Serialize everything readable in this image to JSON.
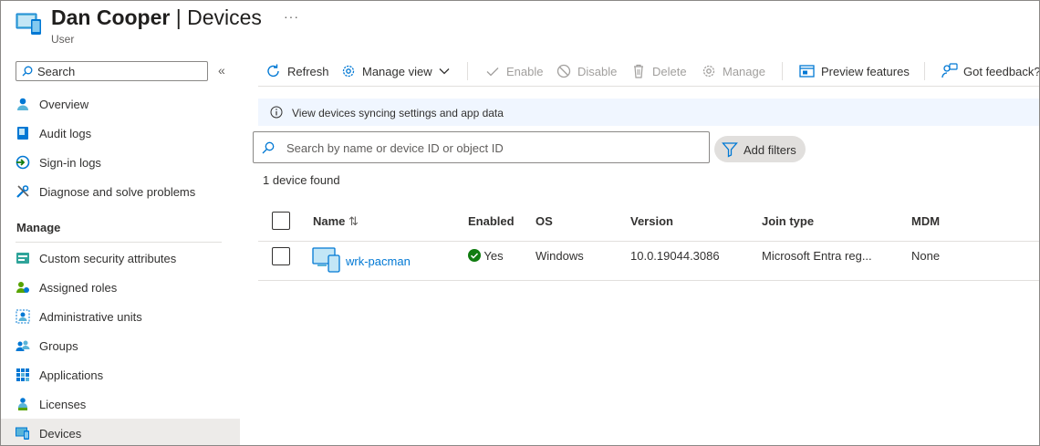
{
  "header": {
    "user": "Dan Cooper",
    "separator": " | ",
    "page": "Devices",
    "more": "···",
    "subtitle": "User"
  },
  "sidebar": {
    "search_placeholder": "Search",
    "collapse": "«",
    "items": [
      {
        "label": "Overview",
        "icon": "person-icon"
      },
      {
        "label": "Audit logs",
        "icon": "audit-log-icon"
      },
      {
        "label": "Sign-in logs",
        "icon": "sign-in-icon"
      },
      {
        "label": "Diagnose and solve problems",
        "icon": "wrench-icon"
      }
    ],
    "section_label": "Manage",
    "manage_items": [
      {
        "label": "Custom security attributes",
        "icon": "security-attributes-icon"
      },
      {
        "label": "Assigned roles",
        "icon": "roles-icon"
      },
      {
        "label": "Administrative units",
        "icon": "admin-units-icon"
      },
      {
        "label": "Groups",
        "icon": "groups-icon"
      },
      {
        "label": "Applications",
        "icon": "applications-icon"
      },
      {
        "label": "Licenses",
        "icon": "licenses-icon"
      },
      {
        "label": "Devices",
        "icon": "devices-icon",
        "active": true
      }
    ]
  },
  "toolbar": {
    "refresh": "Refresh",
    "manage_view": "Manage view",
    "enable": "Enable",
    "disable": "Disable",
    "delete": "Delete",
    "manage": "Manage",
    "preview_features": "Preview features",
    "feedback": "Got feedback?"
  },
  "info": {
    "text": "View devices syncing settings and app data"
  },
  "filter": {
    "placeholder": "Search by name or device ID or object ID",
    "add_filters": "Add filters"
  },
  "result_count": "1 device found",
  "table": {
    "columns": [
      "Name",
      "Enabled",
      "OS",
      "Version",
      "Join type",
      "MDM"
    ],
    "sort_icon": "⇅",
    "rows": [
      {
        "name": "wrk-pacman",
        "enabled": "Yes",
        "os": "Windows",
        "version": "10.0.19044.3086",
        "join_type": "Microsoft Entra reg...",
        "mdm": "None"
      }
    ]
  },
  "colors": {
    "accent": "#0078d4",
    "success": "#107c10",
    "active_nav": "#edebe9",
    "info_bg": "#f0f6ff"
  }
}
